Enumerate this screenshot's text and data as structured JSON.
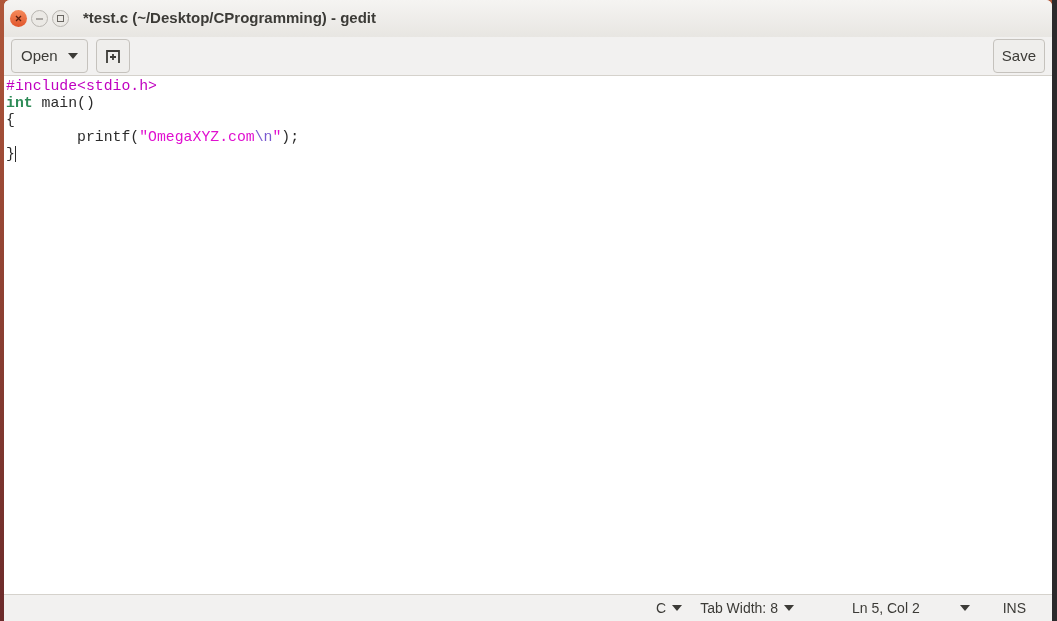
{
  "window": {
    "title": "*test.c (~/Desktop/CProgramming) - gedit"
  },
  "toolbar": {
    "open_button": "Open",
    "save_button": "Save"
  },
  "editor": {
    "lines": [
      {
        "has_cursor": false,
        "tokens": [
          {
            "kind": "preprocessor",
            "text": "#include<stdio.h>"
          }
        ]
      },
      {
        "has_cursor": false,
        "tokens": [
          {
            "kind": "keyword",
            "text": "int"
          },
          {
            "kind": "plain",
            "text": " main()"
          }
        ]
      },
      {
        "has_cursor": false,
        "tokens": [
          {
            "kind": "plain",
            "text": "{"
          }
        ]
      },
      {
        "has_cursor": false,
        "tokens": [
          {
            "kind": "plain",
            "text": "\tprintf("
          },
          {
            "kind": "string",
            "text": "\"OmegaXYZ.com"
          },
          {
            "kind": "escape",
            "text": "\\n"
          },
          {
            "kind": "string",
            "text": "\""
          },
          {
            "kind": "plain",
            "text": ");"
          }
        ]
      },
      {
        "has_cursor": true,
        "tokens": [
          {
            "kind": "plain",
            "text": "}"
          }
        ]
      }
    ]
  },
  "status_bar": {
    "language": "C",
    "tab_width": "Tab Width: 8",
    "position": "Ln 5, Col 2",
    "mode": "INS"
  }
}
